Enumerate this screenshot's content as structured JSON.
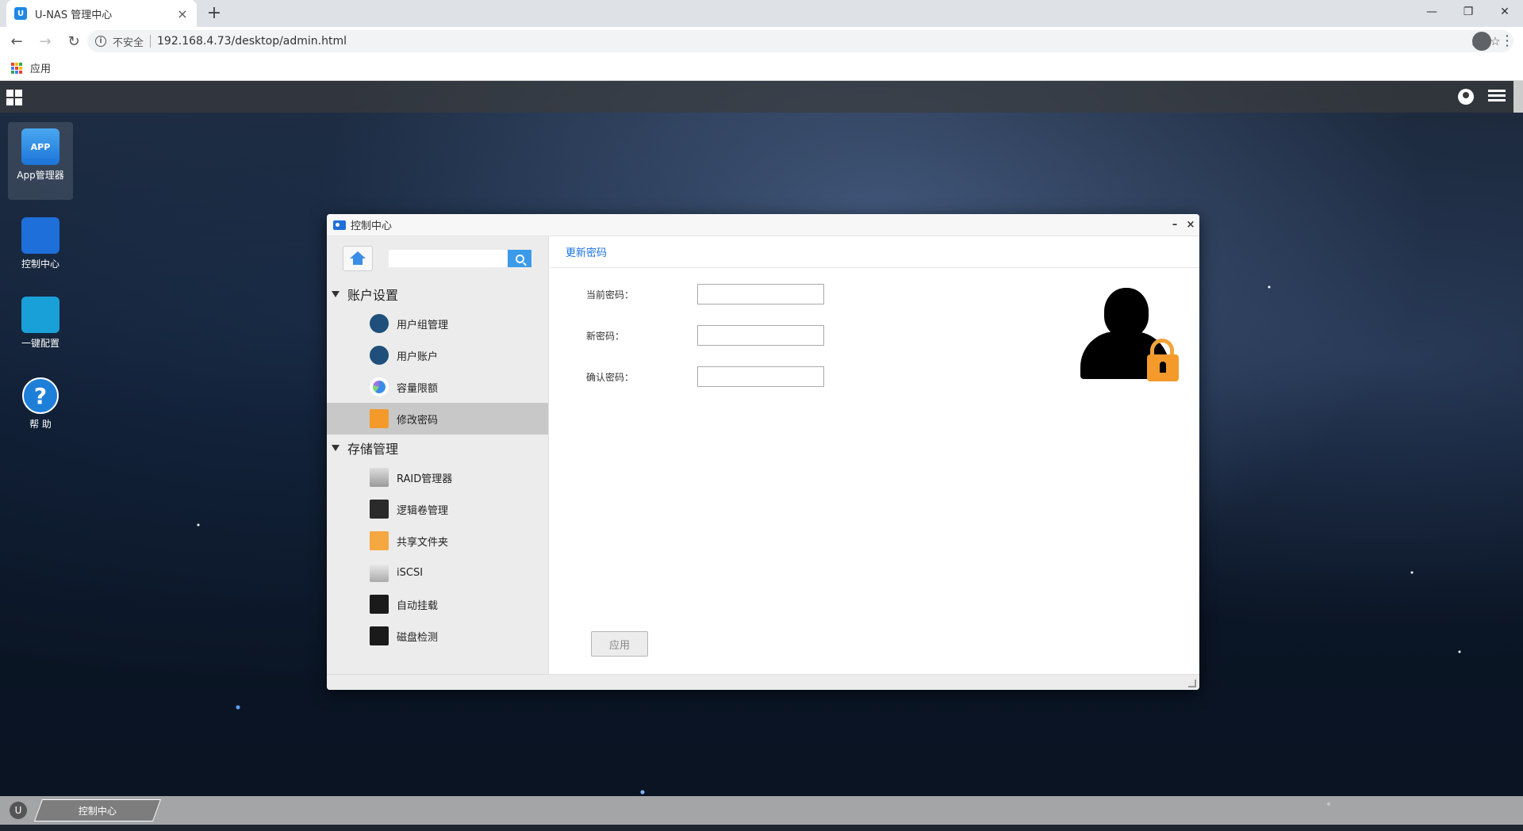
{
  "browser": {
    "tab_title": "U-NAS 管理中心",
    "tab_favicon_letter": "U",
    "new_tab_symbol": "+",
    "window_controls": [
      "—",
      "❐",
      "✕"
    ],
    "security_label": "不安全",
    "url": "192.168.4.73/desktop/admin.html",
    "bookmarks_label": "应用"
  },
  "desktop": {
    "icons": [
      {
        "label": "App管理器",
        "icon": "app-store-icon",
        "glyph": "APP"
      },
      {
        "label": "控制中心",
        "icon": "control-center-icon",
        "glyph": ""
      },
      {
        "label": "一键配置",
        "icon": "mouse-icon",
        "glyph": ""
      },
      {
        "label": "帮 助",
        "icon": "help-icon",
        "glyph": "?"
      }
    ]
  },
  "window": {
    "title": "控制中心",
    "minimize": "–",
    "close": "×",
    "search_placeholder": "",
    "groups": [
      {
        "label": "账户设置",
        "items": [
          {
            "label": "用户组管理",
            "icon": "user-group-icon",
            "active": false
          },
          {
            "label": "用户账户",
            "icon": "user-account-icon",
            "active": false
          },
          {
            "label": "容量限额",
            "icon": "quota-icon",
            "active": false
          },
          {
            "label": "修改密码",
            "icon": "lock-icon",
            "active": true
          }
        ]
      },
      {
        "label": "存储管理",
        "items": [
          {
            "label": "RAID管理器",
            "icon": "raid-icon",
            "active": false
          },
          {
            "label": "逻辑卷管理",
            "icon": "lvm-icon",
            "active": false
          },
          {
            "label": "共享文件夹",
            "icon": "shared-folder-icon",
            "active": false
          },
          {
            "label": "iSCSI",
            "icon": "iscsi-icon",
            "active": false
          },
          {
            "label": "自动挂载",
            "icon": "automount-icon",
            "active": false
          },
          {
            "label": "磁盘检测",
            "icon": "disk-check-icon",
            "active": false
          }
        ]
      }
    ],
    "content": {
      "tab": "更新密码",
      "fields": [
        {
          "label": "当前密码：",
          "value": ""
        },
        {
          "label": "新密码：",
          "value": ""
        },
        {
          "label": "确认密码：",
          "value": ""
        }
      ],
      "apply_label": "应用"
    }
  },
  "taskbar": {
    "logo": "U",
    "task_label": "控制中心"
  },
  "colors": {
    "accent": "#1a73e8",
    "search_button": "#3b9be8",
    "lock": "#f39a2b"
  }
}
